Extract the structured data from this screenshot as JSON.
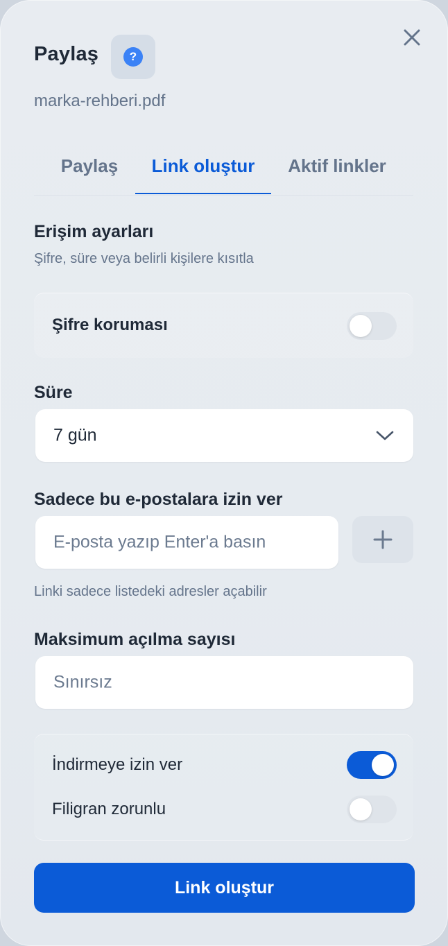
{
  "header": {
    "title": "Paylaş",
    "help_icon_glyph": "?",
    "filename": "marka-rehberi.pdf"
  },
  "tabs": [
    {
      "label": "Paylaş",
      "active": false
    },
    {
      "label": "Link oluştur",
      "active": true
    },
    {
      "label": "Aktif linkler",
      "active": false
    }
  ],
  "access": {
    "title": "Erişim ayarları",
    "subtitle": "Şifre, süre veya belirli kişilere kısıtla",
    "password_label": "Şifre koruması",
    "password_enabled": false
  },
  "duration": {
    "label": "Süre",
    "value": "7 gün"
  },
  "emails": {
    "label": "Sadece bu e-postalara izin ver",
    "placeholder": "E-posta yazıp Enter'a basın",
    "hint": "Linki sadece listedeki adresler açabilir"
  },
  "max_opens": {
    "label": "Maksimum açılma sayısı",
    "placeholder": "Sınırsız"
  },
  "options": [
    {
      "label": "İndirmeye izin ver",
      "enabled": true
    },
    {
      "label": "Filigran zorunlu",
      "enabled": false
    }
  ],
  "submit_label": "Link oluştur",
  "colors": {
    "accent": "#0b5bd7",
    "help_icon": "#3b82f6"
  }
}
